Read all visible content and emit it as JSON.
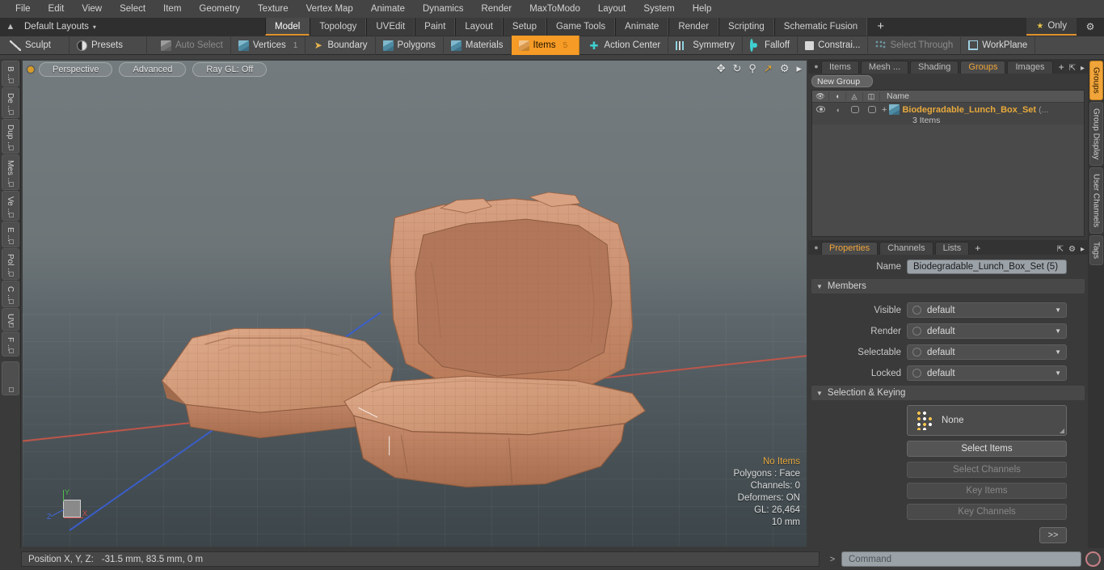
{
  "menu": [
    "File",
    "Edit",
    "View",
    "Select",
    "Item",
    "Geometry",
    "Texture",
    "Vertex Map",
    "Animate",
    "Dynamics",
    "Render",
    "MaxToModo",
    "Layout",
    "System",
    "Help"
  ],
  "layout_bar": {
    "home_icon": "home-icon",
    "preset_label": "Default Layouts",
    "caret": "▾",
    "tabs": [
      "Model",
      "Topology",
      "UVEdit",
      "Paint",
      "Layout",
      "Setup",
      "Game Tools",
      "Animate",
      "Render",
      "Scripting",
      "Schematic Fusion"
    ],
    "active_tab": "Model",
    "add_label": "+",
    "only_label": "Only",
    "star_icon": "★",
    "gear_icon": "⚙"
  },
  "modebar": {
    "left": [
      {
        "label": "Sculpt",
        "icon": "sculpt-icon"
      },
      {
        "label": "Presets",
        "icon": "presets-sphere-icon"
      }
    ],
    "selection": [
      {
        "label": "Auto Select",
        "icon": "cube-gray-icon",
        "state": "disabled",
        "badge": ""
      },
      {
        "label": "Vertices",
        "icon": "cube-blue-icon",
        "state": "normal",
        "badge": "1"
      },
      {
        "label": "Boundary",
        "icon": "boundary-arrow-icon",
        "state": "normal",
        "badge": ""
      },
      {
        "label": "Polygons",
        "icon": "cube-blue-icon",
        "state": "normal",
        "badge": ""
      },
      {
        "label": "Materials",
        "icon": "cube-blue-icon",
        "state": "normal",
        "badge": ""
      },
      {
        "label": "Items",
        "icon": "cube-orange-icon",
        "state": "selected",
        "badge": "5"
      }
    ],
    "tools": [
      {
        "label": "Action Center",
        "icon": "crosshair-icon",
        "state": "normal"
      },
      {
        "label": "Symmetry",
        "icon": "symmetry-bars-icon",
        "state": "normal"
      },
      {
        "label": "Falloff",
        "icon": "falloff-ring-icon",
        "state": "normal"
      },
      {
        "label": "Constrai...",
        "icon": "constraint-square-icon",
        "state": "normal"
      },
      {
        "label": "Select Through",
        "icon": "select-through-dots-icon",
        "state": "disabled"
      },
      {
        "label": "WorkPlane",
        "icon": "workplane-icon",
        "state": "normal"
      }
    ]
  },
  "left_rail": [
    "B ...",
    "De ...",
    "Dup ...",
    "Mes ...",
    "Ve ...",
    "E ...",
    "Pol ...",
    "C ...",
    "UV",
    "F ..."
  ],
  "viewport": {
    "dot_icon": "viewport-indicator",
    "pills": [
      "Perspective",
      "Advanced",
      "Ray GL: Off"
    ],
    "icons": [
      "move-icon",
      "rotate-icon",
      "zoom-icon",
      "fit-icon",
      "gear-icon",
      "chevron-right-icon"
    ],
    "gizmo": {
      "x": "X",
      "y": "Y",
      "z": "Z"
    },
    "stats": {
      "selection": "No Items",
      "polygons": "Polygons : Face",
      "channels": "Channels: 0",
      "deformers": "Deformers: ON",
      "gl": "GL: 26,464",
      "scale": "10 mm"
    },
    "model_color": "#c89070"
  },
  "right_panel": {
    "tabs": [
      "Items",
      "Mesh ...",
      "Shading",
      "Groups",
      "Images"
    ],
    "active_tab": "Groups",
    "add_label": "+",
    "corner_icons": [
      "expand-icon",
      "chevron-right-icon"
    ],
    "new_group_label": "New Group",
    "list": {
      "columns": [
        "eye-icon",
        "ghost-icon",
        "wireframe-icon",
        "shaded-icon"
      ],
      "name_header": "Name",
      "rows": [
        {
          "expander": "+",
          "icon": "group-cube-icon",
          "name": "Biodegradable_Lunch_Box_Set",
          "suffix": "(...",
          "sub": "3 Items"
        }
      ]
    }
  },
  "properties": {
    "tabs": [
      "Properties",
      "Channels",
      "Lists"
    ],
    "active_tab": "Properties",
    "add_label": "+",
    "corner_icons": [
      "expand-icon",
      "gear-icon",
      "chevron-right-icon"
    ],
    "name_label": "Name",
    "name_value": "Biodegradable_Lunch_Box_Set (5)",
    "members_section": "Members",
    "members": [
      {
        "label": "Visible",
        "value": "default"
      },
      {
        "label": "Render",
        "value": "default"
      },
      {
        "label": "Selectable",
        "value": "default"
      },
      {
        "label": "Locked",
        "value": "default"
      }
    ],
    "keying_section": "Selection & Keying",
    "keying_preview": "None",
    "keying_buttons": [
      {
        "label": "Select Items",
        "enabled": true
      },
      {
        "label": "Select Channels",
        "enabled": false
      },
      {
        "label": "Key Items",
        "enabled": false
      },
      {
        "label": "Key Channels",
        "enabled": false
      }
    ],
    "forward_label": ">>"
  },
  "right_rail": [
    "Groups",
    "Group Display",
    "User Channels",
    "Tags"
  ],
  "right_rail_active": "Groups",
  "status": {
    "position_label": "Position X, Y, Z:",
    "position_value": "-31.5 mm, 83.5 mm, 0 m",
    "command_arrow": ">",
    "command_placeholder": "Command",
    "record_icon": "record-icon"
  },
  "colors": {
    "accent": "#f0a43a",
    "selected": "#f59b26",
    "model": "#c89070"
  }
}
